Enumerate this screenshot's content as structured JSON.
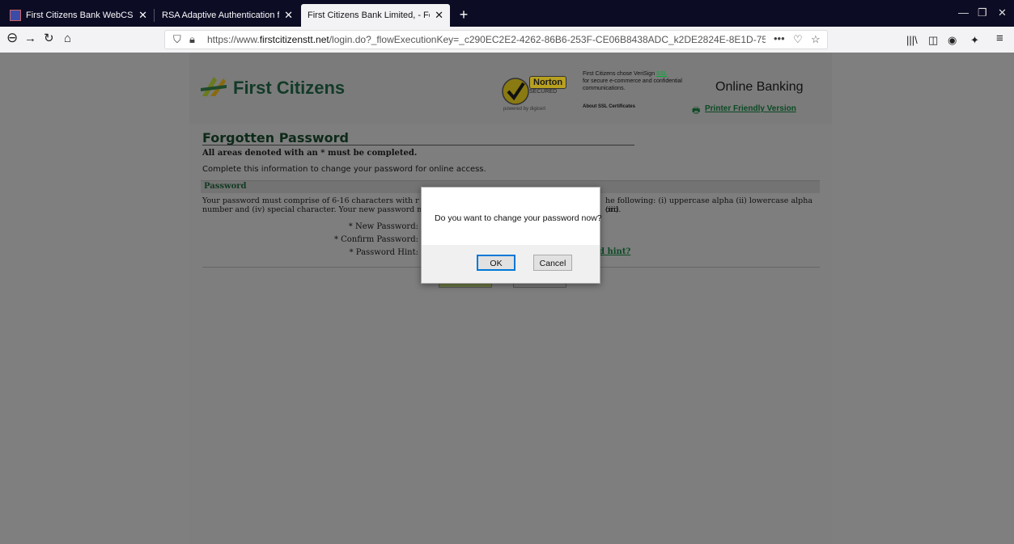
{
  "browser": {
    "tabs": [
      {
        "title": "First Citizens Bank WebCSR - C"
      },
      {
        "title": "RSA Adaptive Authentication for W"
      },
      {
        "title": "First Citizens Bank Limited, - Forgot"
      }
    ],
    "url_prefix": "https://www.",
    "url_domain": "firstcitizenstt.net",
    "url_rest": "/login.do?_flowExecutionKey=_c290EC2E2-4262-86B6-253F-CE06B8438ADC_k2DE2824E-8E1D-75B2-B121"
  },
  "header": {
    "logo_text": "First Citizens",
    "norton_brand": "Norton",
    "norton_secured": "SECURED",
    "norton_powered": "powered by digicert",
    "verisign_text": "First Citizens chose VeriSign",
    "verisign_ssl": "SSL",
    "verisign_text2": "for secure e-commerce and confidential communications.",
    "about_ssl": "About SSL Certificates",
    "online_banking": "Online Banking",
    "printer_friendly": "Printer Friendly Version"
  },
  "form": {
    "title": "Forgotten Password",
    "required_note": "All areas denoted with an * must be completed.",
    "intro": "Complete this information to change your password for online access.",
    "section_title": "Password",
    "rules_left": "Your password must comprise of 6-16 characters with r",
    "rules_right": "he following: (i) uppercase alpha (ii) lowercase alpha (iii)",
    "rules_line2_left": "number and (iv) special character. Your new password m",
    "rules_line2_right": "ord.",
    "new_password_label": "* New Password:",
    "confirm_password_label": "* Confirm Password:",
    "password_hint_label": "* Password Hint:",
    "hint_link": "d hint?",
    "submit_label": "Submit",
    "cancel_label": "Cancel"
  },
  "dialog": {
    "message": "Do you want to change your password now?",
    "ok_label": "OK",
    "cancel_label": "Cancel"
  }
}
